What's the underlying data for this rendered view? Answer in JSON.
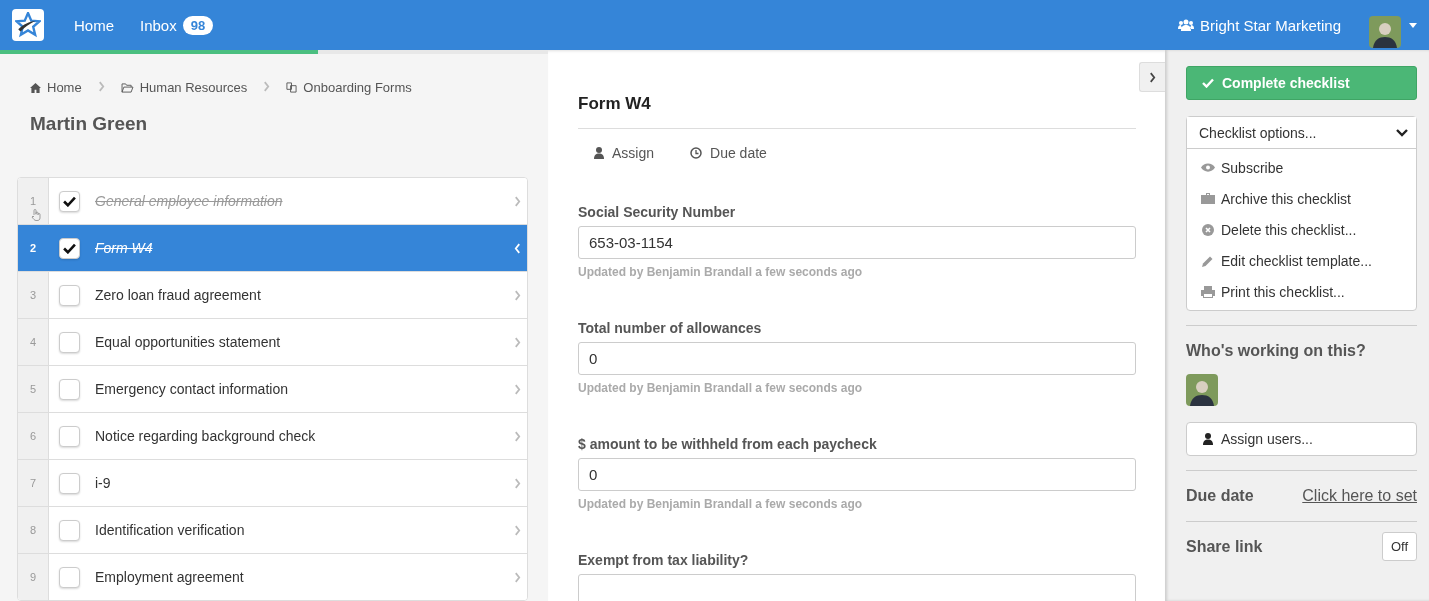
{
  "topbar": {
    "nav": [
      {
        "label": "Home"
      },
      {
        "label": "Inbox",
        "badge": "98"
      }
    ],
    "org": "Bright Star Marketing"
  },
  "progress": {
    "level": 0.58
  },
  "breadcrumb": [
    {
      "label": "Home",
      "kind": "home"
    },
    {
      "label": "Human Resources",
      "kind": "folder"
    },
    {
      "label": "Onboarding Forms",
      "kind": "forms"
    }
  ],
  "checklist_title": "Martin Green",
  "tasks": [
    {
      "number": "1",
      "label": "General employee information",
      "checked": true,
      "selected": false,
      "hovered": true
    },
    {
      "number": "2",
      "label": "Form W4",
      "checked": true,
      "selected": true,
      "hovered": false
    },
    {
      "number": "3",
      "label": "Zero loan fraud agreement",
      "checked": false,
      "selected": false,
      "hovered": false
    },
    {
      "number": "4",
      "label": "Equal opportunities statement",
      "checked": false,
      "selected": false,
      "hovered": false
    },
    {
      "number": "5",
      "label": "Emergency contact information",
      "checked": false,
      "selected": false,
      "hovered": false
    },
    {
      "number": "6",
      "label": "Notice regarding background check",
      "checked": false,
      "selected": false,
      "hovered": false
    },
    {
      "number": "7",
      "label": "i-9",
      "checked": false,
      "selected": false,
      "hovered": false
    },
    {
      "number": "8",
      "label": "Identification verification",
      "checked": false,
      "selected": false,
      "hovered": false
    },
    {
      "number": "9",
      "label": "Employment agreement",
      "checked": false,
      "selected": false,
      "hovered": false
    }
  ],
  "task_detail": {
    "title": "Form W4",
    "actions": [
      {
        "label": "Assign",
        "kind": "user"
      },
      {
        "label": "Due date",
        "kind": "clock"
      }
    ],
    "fields": [
      {
        "label": "Social Security Number",
        "value": "653-03-1154",
        "note": "Updated by Benjamin Brandall a few seconds ago"
      },
      {
        "label": "Total number of allowances",
        "value": "0",
        "note": "Updated by Benjamin Brandall a few seconds ago"
      },
      {
        "label": "$ amount to be withheld from each paycheck",
        "value": "0",
        "note": "Updated by Benjamin Brandall a few seconds ago"
      },
      {
        "label": "Exempt from tax liability?"
      }
    ]
  },
  "sidebar": {
    "complete_button": "Complete checklist",
    "options": {
      "label": "Checklist options...",
      "expanded": true,
      "items": [
        {
          "label": "Subscribe",
          "kind": "eye"
        },
        {
          "label": "Archive this checklist",
          "kind": "briefcase"
        },
        {
          "label": "Delete this checklist...",
          "kind": "delete"
        },
        {
          "label": "Edit checklist template...",
          "kind": "pencil"
        },
        {
          "label": "Print this checklist...",
          "kind": "print"
        }
      ]
    },
    "working_heading": "Who's working on this?",
    "assign_button": "Assign users...",
    "due_date_label": "Due date",
    "due_date_link": "Click here to set",
    "share_label": "Share link",
    "share_toggle": "Off"
  }
}
